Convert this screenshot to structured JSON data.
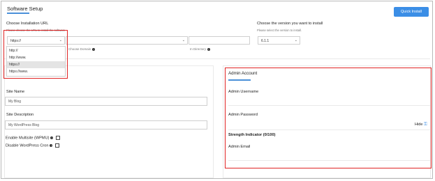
{
  "header": {
    "title": "Software Setup",
    "quick_install_label": "Quick Install"
  },
  "url_section": {
    "title": "Choose Installation URL",
    "help": "Please choose the URL to install the software",
    "protocol_selected": "https://",
    "protocol_options": [
      "http://",
      "http://www.",
      "https://",
      "https://www."
    ],
    "domain_label": "Choose Domain",
    "directory_label": "In Directory"
  },
  "version_section": {
    "title": "Choose the version you want to install",
    "help": "Please select the version to install.",
    "selected": "6.1.1"
  },
  "site": {
    "site_name_label": "Site Name",
    "site_name_value": "My Blog",
    "site_desc_label": "Site Description",
    "site_desc_value": "My WordPress Blog",
    "multisite_label": "Enable Multisite (WPMU)",
    "cron_label": "Disable WordPress Cron"
  },
  "admin": {
    "title": "Admin Account",
    "username_label": "Admin Username",
    "password_label": "Admin Password",
    "hide_label": "Hide",
    "strength_label": "Strength Indicator (0/100)",
    "email_label": "Admin Email"
  },
  "colors": {
    "accent": "#3b8ee6",
    "highlight": "#e02424"
  },
  "icons": {
    "info": "info-icon",
    "key": "key-icon",
    "chevron": "chevron-down-icon"
  }
}
